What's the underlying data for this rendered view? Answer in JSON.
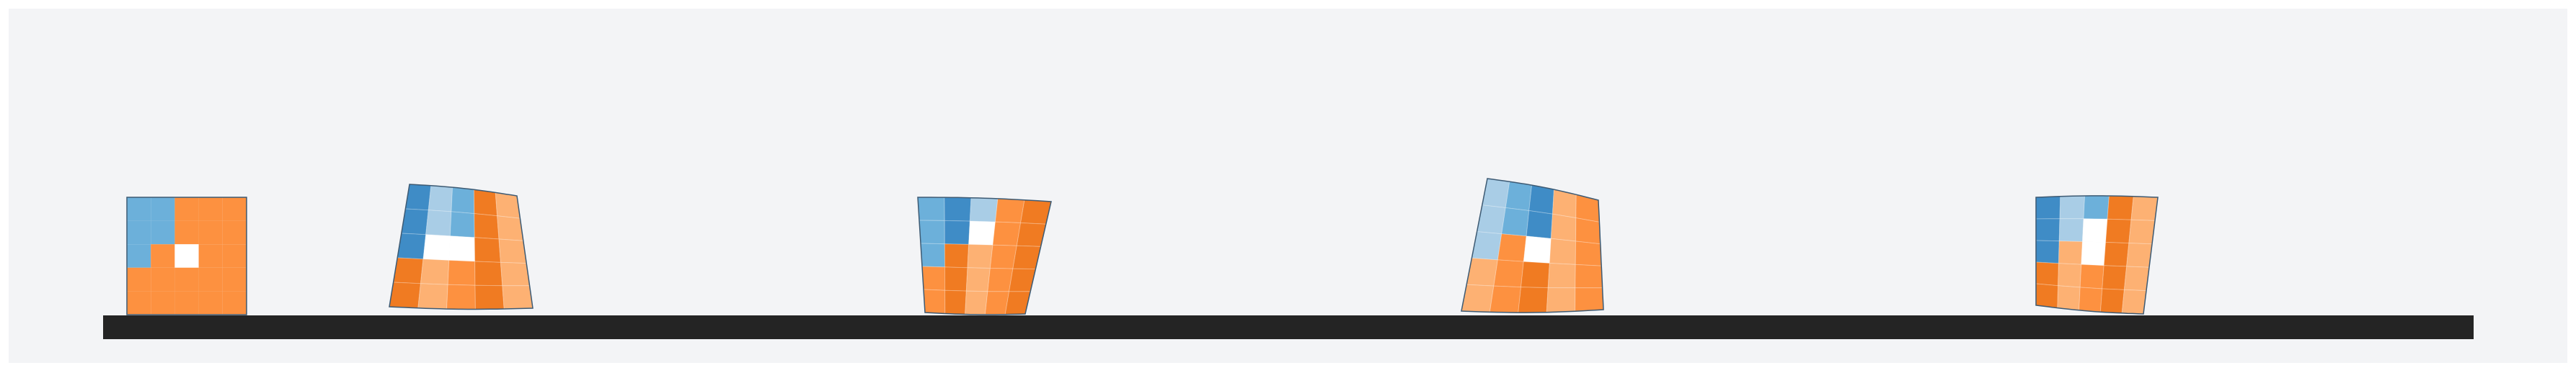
{
  "scene": {
    "background_color": "#f3f4f6",
    "ground_color": "#242424",
    "outline_color": "#3d5a73",
    "hole_color": "#ffffff",
    "frame_count": 5,
    "frames": [
      {
        "pose": "initial"
      },
      {
        "pose": "deformed-1"
      },
      {
        "pose": "deformed-2"
      },
      {
        "pose": "deformed-3"
      },
      {
        "pose": "deformed-4"
      }
    ],
    "palette": {
      "blue_light": "#a9cde6",
      "blue_mid": "#6cb0da",
      "blue_dark": "#3f8cc6",
      "orange_light": "#fdb173",
      "orange_mid": "#fd9140",
      "orange_dark": "#f07b22"
    }
  }
}
